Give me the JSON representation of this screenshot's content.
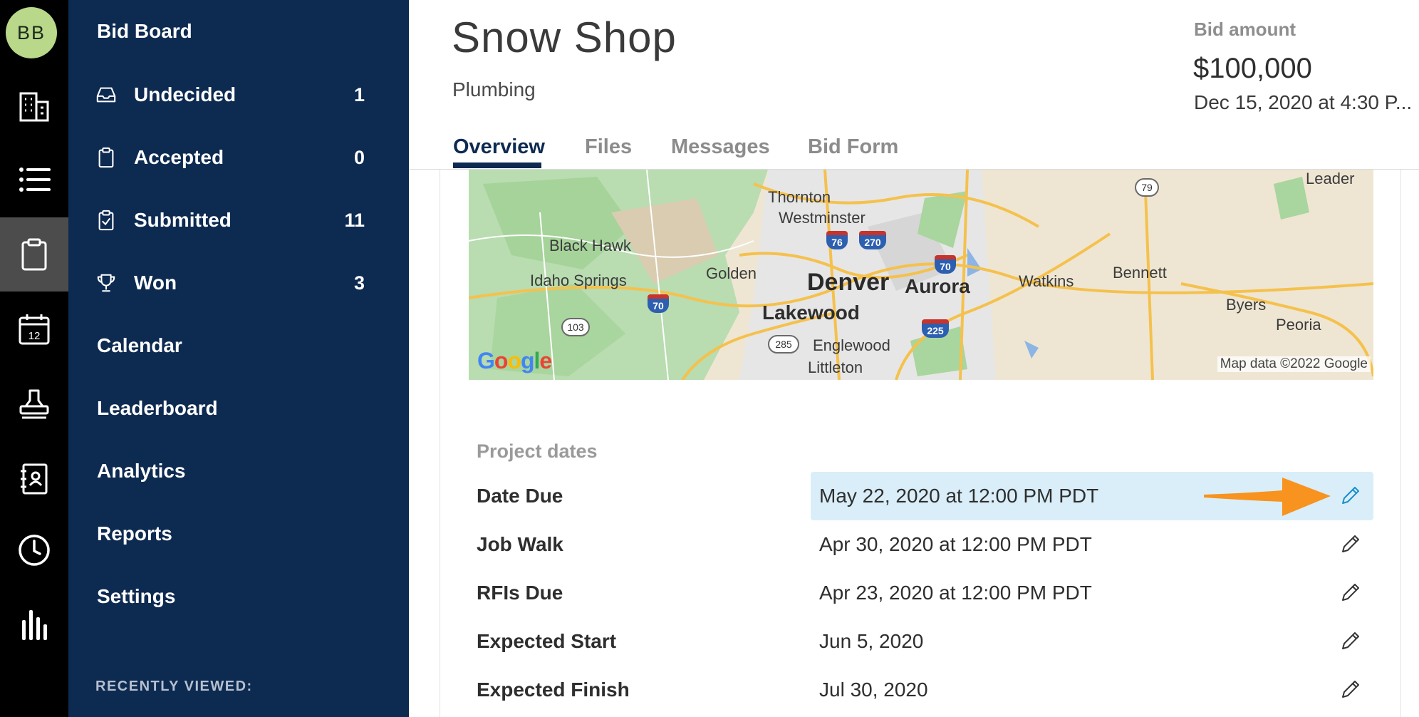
{
  "user": {
    "initials": "BB"
  },
  "rail": {
    "icons": [
      "building-icon",
      "list-icon",
      "clipboard-icon",
      "calendar-icon",
      "stamp-icon",
      "contacts-book-icon",
      "clock-icon",
      "bar-chart-icon"
    ],
    "calendar_day": "12"
  },
  "nav": {
    "header": "Bid Board",
    "items": [
      {
        "label": "Undecided",
        "count": "1",
        "icon": "inbox-icon"
      },
      {
        "label": "Accepted",
        "count": "0",
        "icon": "clipboard-icon"
      },
      {
        "label": "Submitted",
        "count": "11",
        "icon": "clipboard-check-icon"
      },
      {
        "label": "Won",
        "count": "3",
        "icon": "trophy-icon"
      }
    ],
    "links": [
      "Calendar",
      "Leaderboard",
      "Analytics",
      "Reports",
      "Settings"
    ],
    "recent_heading": "RECENTLY VIEWED:"
  },
  "project": {
    "title": "Snow Shop",
    "trade": "Plumbing",
    "bid_label": "Bid amount",
    "bid_amount": "$100,000",
    "bid_date": "Dec 15, 2020 at 4:30 P..."
  },
  "tabs": [
    {
      "label": "Overview",
      "active": true
    },
    {
      "label": "Files",
      "active": false
    },
    {
      "label": "Messages",
      "active": false
    },
    {
      "label": "Bid Form",
      "active": false
    }
  ],
  "map": {
    "places": [
      "Thornton",
      "Westminster",
      "Black Hawk",
      "Golden",
      "Idaho Springs",
      "Denver",
      "Aurora",
      "Lakewood",
      "Englewood",
      "Littleton",
      "Watkins",
      "Bennett",
      "Byers",
      "Peoria",
      "Leader"
    ],
    "shields": [
      "76",
      "270",
      "70",
      "70",
      "225"
    ],
    "routes": [
      "79",
      "103",
      "285"
    ],
    "logo": "Google",
    "credit": "Map data ©2022 Google"
  },
  "dates": {
    "heading": "Project dates",
    "rows": [
      {
        "label": "Date Due",
        "value": "May 22, 2020 at 12:00 PM PDT",
        "highlighted": true
      },
      {
        "label": "Job Walk",
        "value": "Apr 30, 2020 at 12:00 PM PDT",
        "highlighted": false
      },
      {
        "label": "RFIs Due",
        "value": "Apr 23, 2020 at 12:00 PM PDT",
        "highlighted": false
      },
      {
        "label": "Expected Start",
        "value": "Jun 5, 2020",
        "highlighted": false
      },
      {
        "label": "Expected Finish",
        "value": "Jul 30, 2020",
        "highlighted": false
      }
    ]
  },
  "colors": {
    "nav_bg": "#0d2a51",
    "rail_bg": "#000000",
    "highlight_row": "#d9eef9",
    "annotation_arrow": "#f7931e",
    "accent_pencil": "#1a8fc9"
  }
}
